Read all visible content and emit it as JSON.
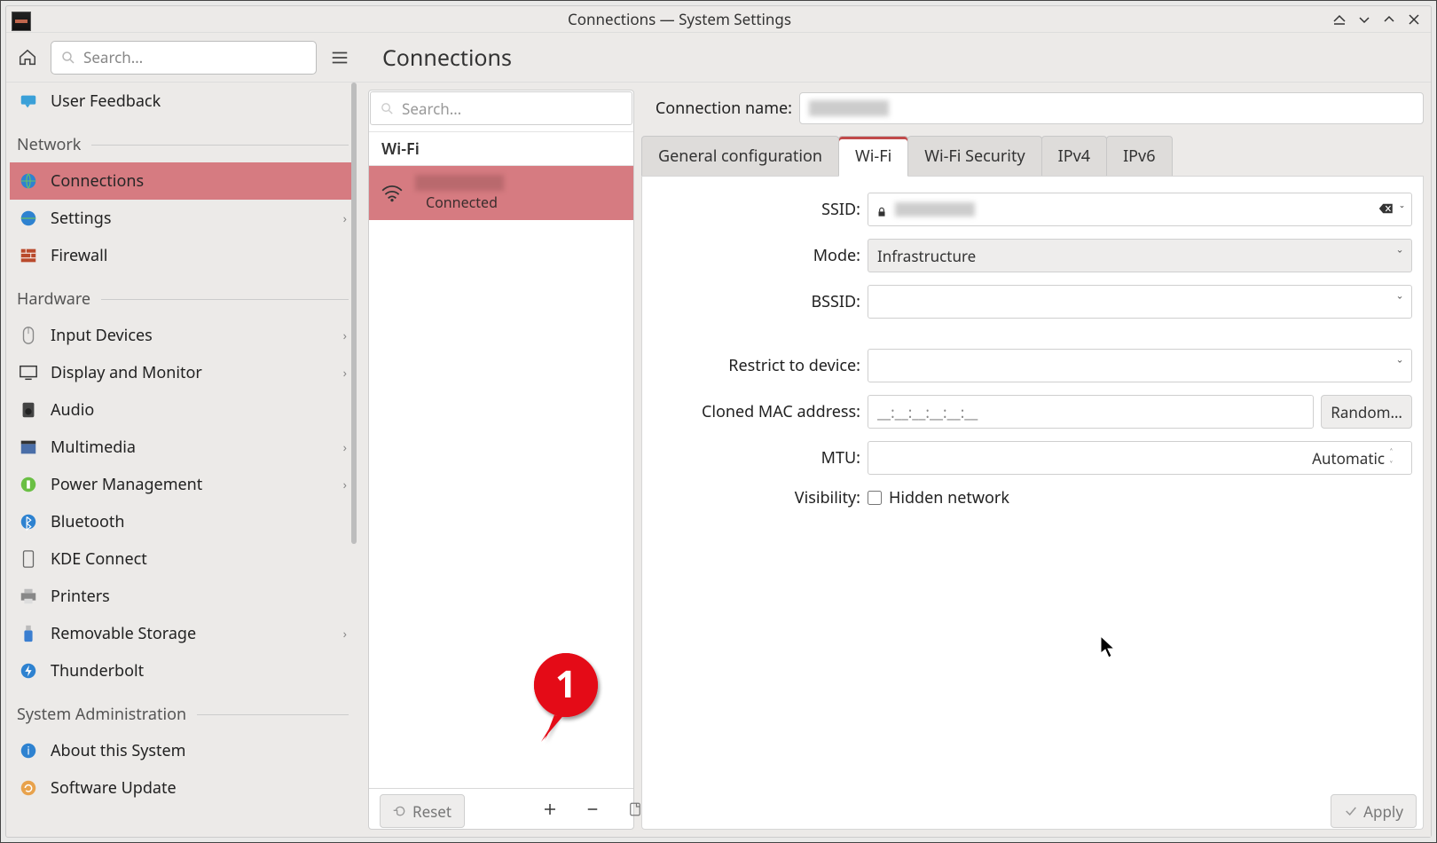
{
  "window": {
    "title": "Connections — System Settings"
  },
  "sidebar_search": {
    "placeholder": "Search…"
  },
  "header": {
    "title": "Connections"
  },
  "sidebar": {
    "top": {
      "user_feedback": "User Feedback"
    },
    "sections": {
      "network": "Network",
      "hardware": "Hardware",
      "sysadmin": "System Administration"
    },
    "items": {
      "connections": "Connections",
      "settings": "Settings",
      "firewall": "Firewall",
      "input_devices": "Input Devices",
      "display": "Display and Monitor",
      "audio": "Audio",
      "multimedia": "Multimedia",
      "power": "Power Management",
      "bluetooth": "Bluetooth",
      "kde_connect": "KDE Connect",
      "printers": "Printers",
      "removable": "Removable Storage",
      "thunderbolt": "Thunderbolt",
      "about": "About this System",
      "software_update": "Software Update"
    }
  },
  "connections_list": {
    "search_placeholder": "Search…",
    "section": "Wi-Fi",
    "item_status": "Connected"
  },
  "details": {
    "name_label": "Connection name:",
    "tabs": {
      "general": "General configuration",
      "wifi": "Wi-Fi",
      "security": "Wi-Fi Security",
      "ipv4": "IPv4",
      "ipv6": "IPv6"
    },
    "fields": {
      "ssid": "SSID:",
      "mode": "Mode:",
      "mode_value": "Infrastructure",
      "bssid": "BSSID:",
      "restrict": "Restrict to device:",
      "mac": "Cloned MAC address:",
      "mac_placeholder": "__:__:__:__:__:__",
      "random": "Random…",
      "mtu": "MTU:",
      "mtu_value": "Automatic",
      "visibility": "Visibility:",
      "hidden": "Hidden network"
    }
  },
  "buttons": {
    "reset": "Reset",
    "apply": "Apply"
  },
  "callout": {
    "number": "1"
  }
}
